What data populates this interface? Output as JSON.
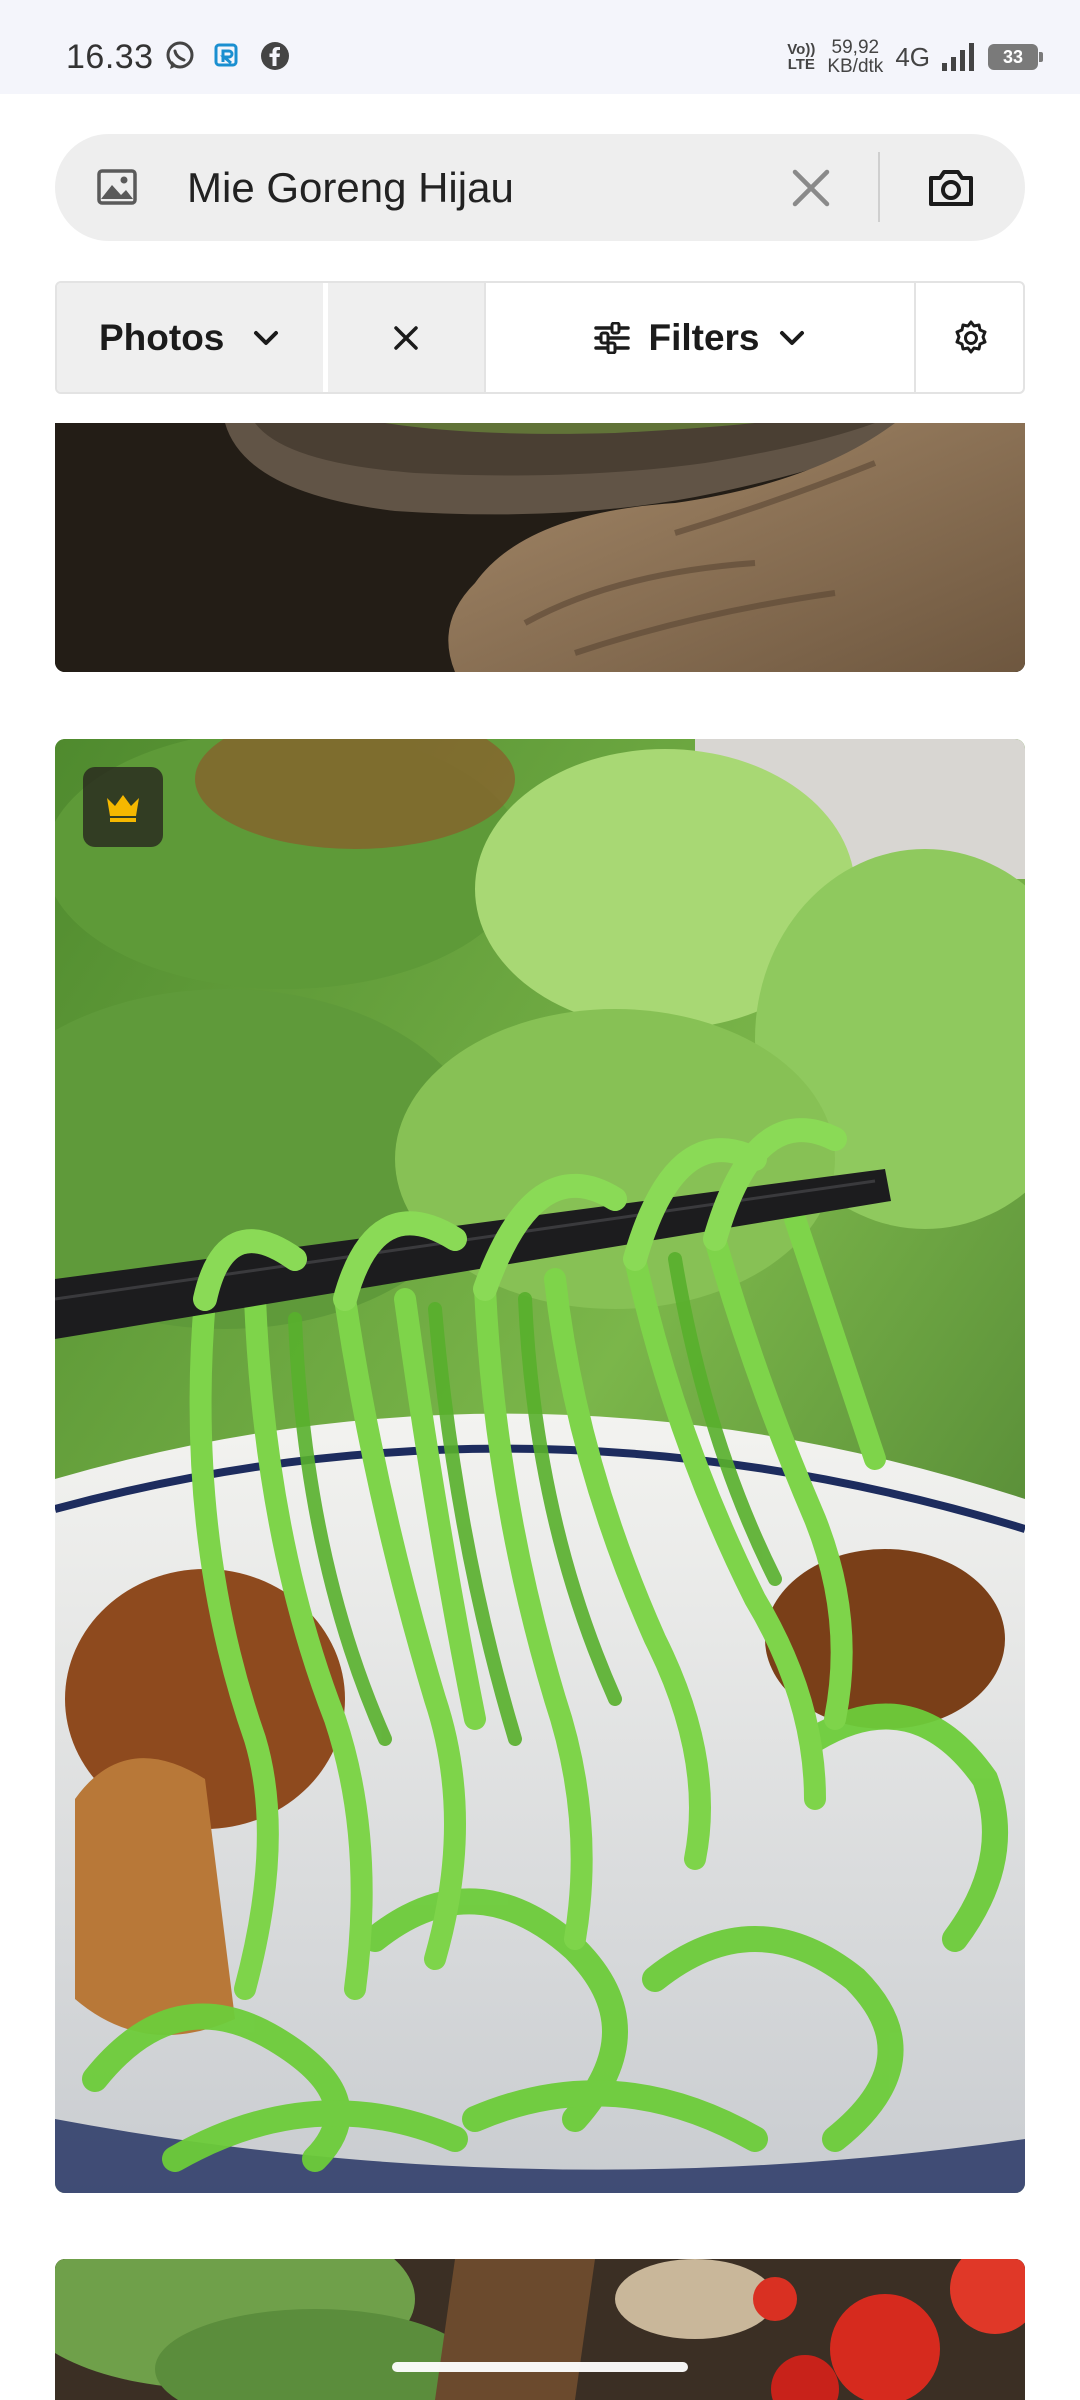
{
  "status_bar": {
    "time": "16.33",
    "volte_top": "Vo))",
    "volte_bottom": "LTE",
    "speed_value": "59,92",
    "speed_unit": "KB/dtk",
    "network": "4G",
    "battery": "33",
    "app_icons": [
      "whatsapp-icon",
      "app-r-icon",
      "facebook-icon"
    ]
  },
  "search": {
    "query": "Mie Goreng Hijau",
    "icons": [
      "image-icon",
      "clear-icon",
      "camera-icon"
    ]
  },
  "filters": {
    "type_label": "Photos",
    "filters_label": "Filters",
    "icons": [
      "chevron-down-icon",
      "close-icon",
      "sliders-icon",
      "gear-icon"
    ]
  },
  "results": [
    {
      "premium": false
    },
    {
      "premium": true,
      "badge_icon": "crown-icon",
      "badge_color": "#f5b800"
    },
    {
      "premium": false
    }
  ]
}
